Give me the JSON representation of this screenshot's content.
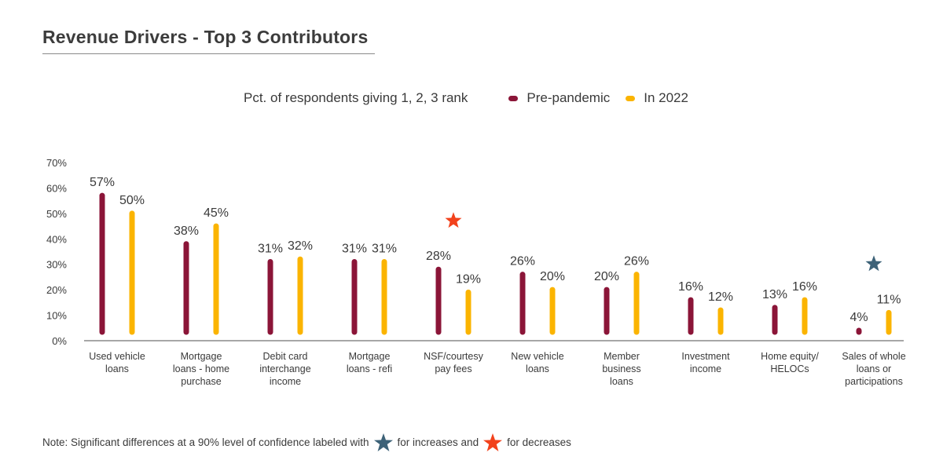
{
  "header": {
    "title": "Revenue Drivers - Top 3 Contributors"
  },
  "legend": {
    "subtitle": "Pct. of respondents giving 1, 2, 3 rank",
    "items": [
      {
        "label": "Pre-pandemic",
        "color": "#8b1538"
      },
      {
        "label": "In 2022",
        "color": "#fbb400"
      }
    ]
  },
  "note": {
    "prefix": "Note: Significant differences at a 90% level of confidence labeled with",
    "middle": "for increases and",
    "suffix": "for decreases",
    "increase_star_color": "#3d6278",
    "decrease_star_color": "#f2421c"
  },
  "chart_data": {
    "type": "bar",
    "title": "Revenue Drivers - Top 3 Contributors",
    "subtitle": "Pct. of respondents giving 1, 2, 3 rank",
    "xlabel": "",
    "ylabel": "",
    "ylim": [
      0,
      70
    ],
    "yticks": [
      "0%",
      "10%",
      "20%",
      "30%",
      "40%",
      "50%",
      "60%",
      "70%"
    ],
    "ytick_values": [
      0,
      10,
      20,
      30,
      40,
      50,
      60,
      70
    ],
    "grid": false,
    "legend_position": "top-center",
    "categories": [
      [
        "Used vehicle",
        "loans"
      ],
      [
        "Mortgage",
        "loans - home",
        "purchase"
      ],
      [
        "Debit card",
        "interchange",
        "income"
      ],
      [
        "Mortgage",
        "loans - refi"
      ],
      [
        "NSF/courtesy",
        "pay fees"
      ],
      [
        "New vehicle",
        "loans"
      ],
      [
        "Member",
        "business",
        "loans"
      ],
      [
        "Investment",
        "income"
      ],
      [
        "Home equity/",
        "HELOCs"
      ],
      [
        "Sales of whole",
        "loans or",
        "participations"
      ]
    ],
    "series": [
      {
        "name": "Pre-pandemic",
        "color": "#8b1538",
        "values": [
          57,
          38,
          31,
          31,
          28,
          26,
          20,
          16,
          13,
          4
        ],
        "labels": [
          "57%",
          "38%",
          "31%",
          "31%",
          "28%",
          "26%",
          "20%",
          "16%",
          "13%",
          "4%"
        ]
      },
      {
        "name": "In 2022",
        "color": "#fbb400",
        "values": [
          50,
          45,
          32,
          31,
          19,
          20,
          26,
          12,
          16,
          11
        ],
        "labels": [
          "50%",
          "45%",
          "32%",
          "31%",
          "19%",
          "20%",
          "26%",
          "12%",
          "16%",
          "11%"
        ]
      }
    ],
    "annotations": [
      {
        "category_index": 4,
        "type": "star",
        "meaning": "significant decrease",
        "color": "#f2421c"
      },
      {
        "category_index": 9,
        "type": "star",
        "meaning": "significant increase",
        "color": "#3d6278"
      }
    ]
  }
}
